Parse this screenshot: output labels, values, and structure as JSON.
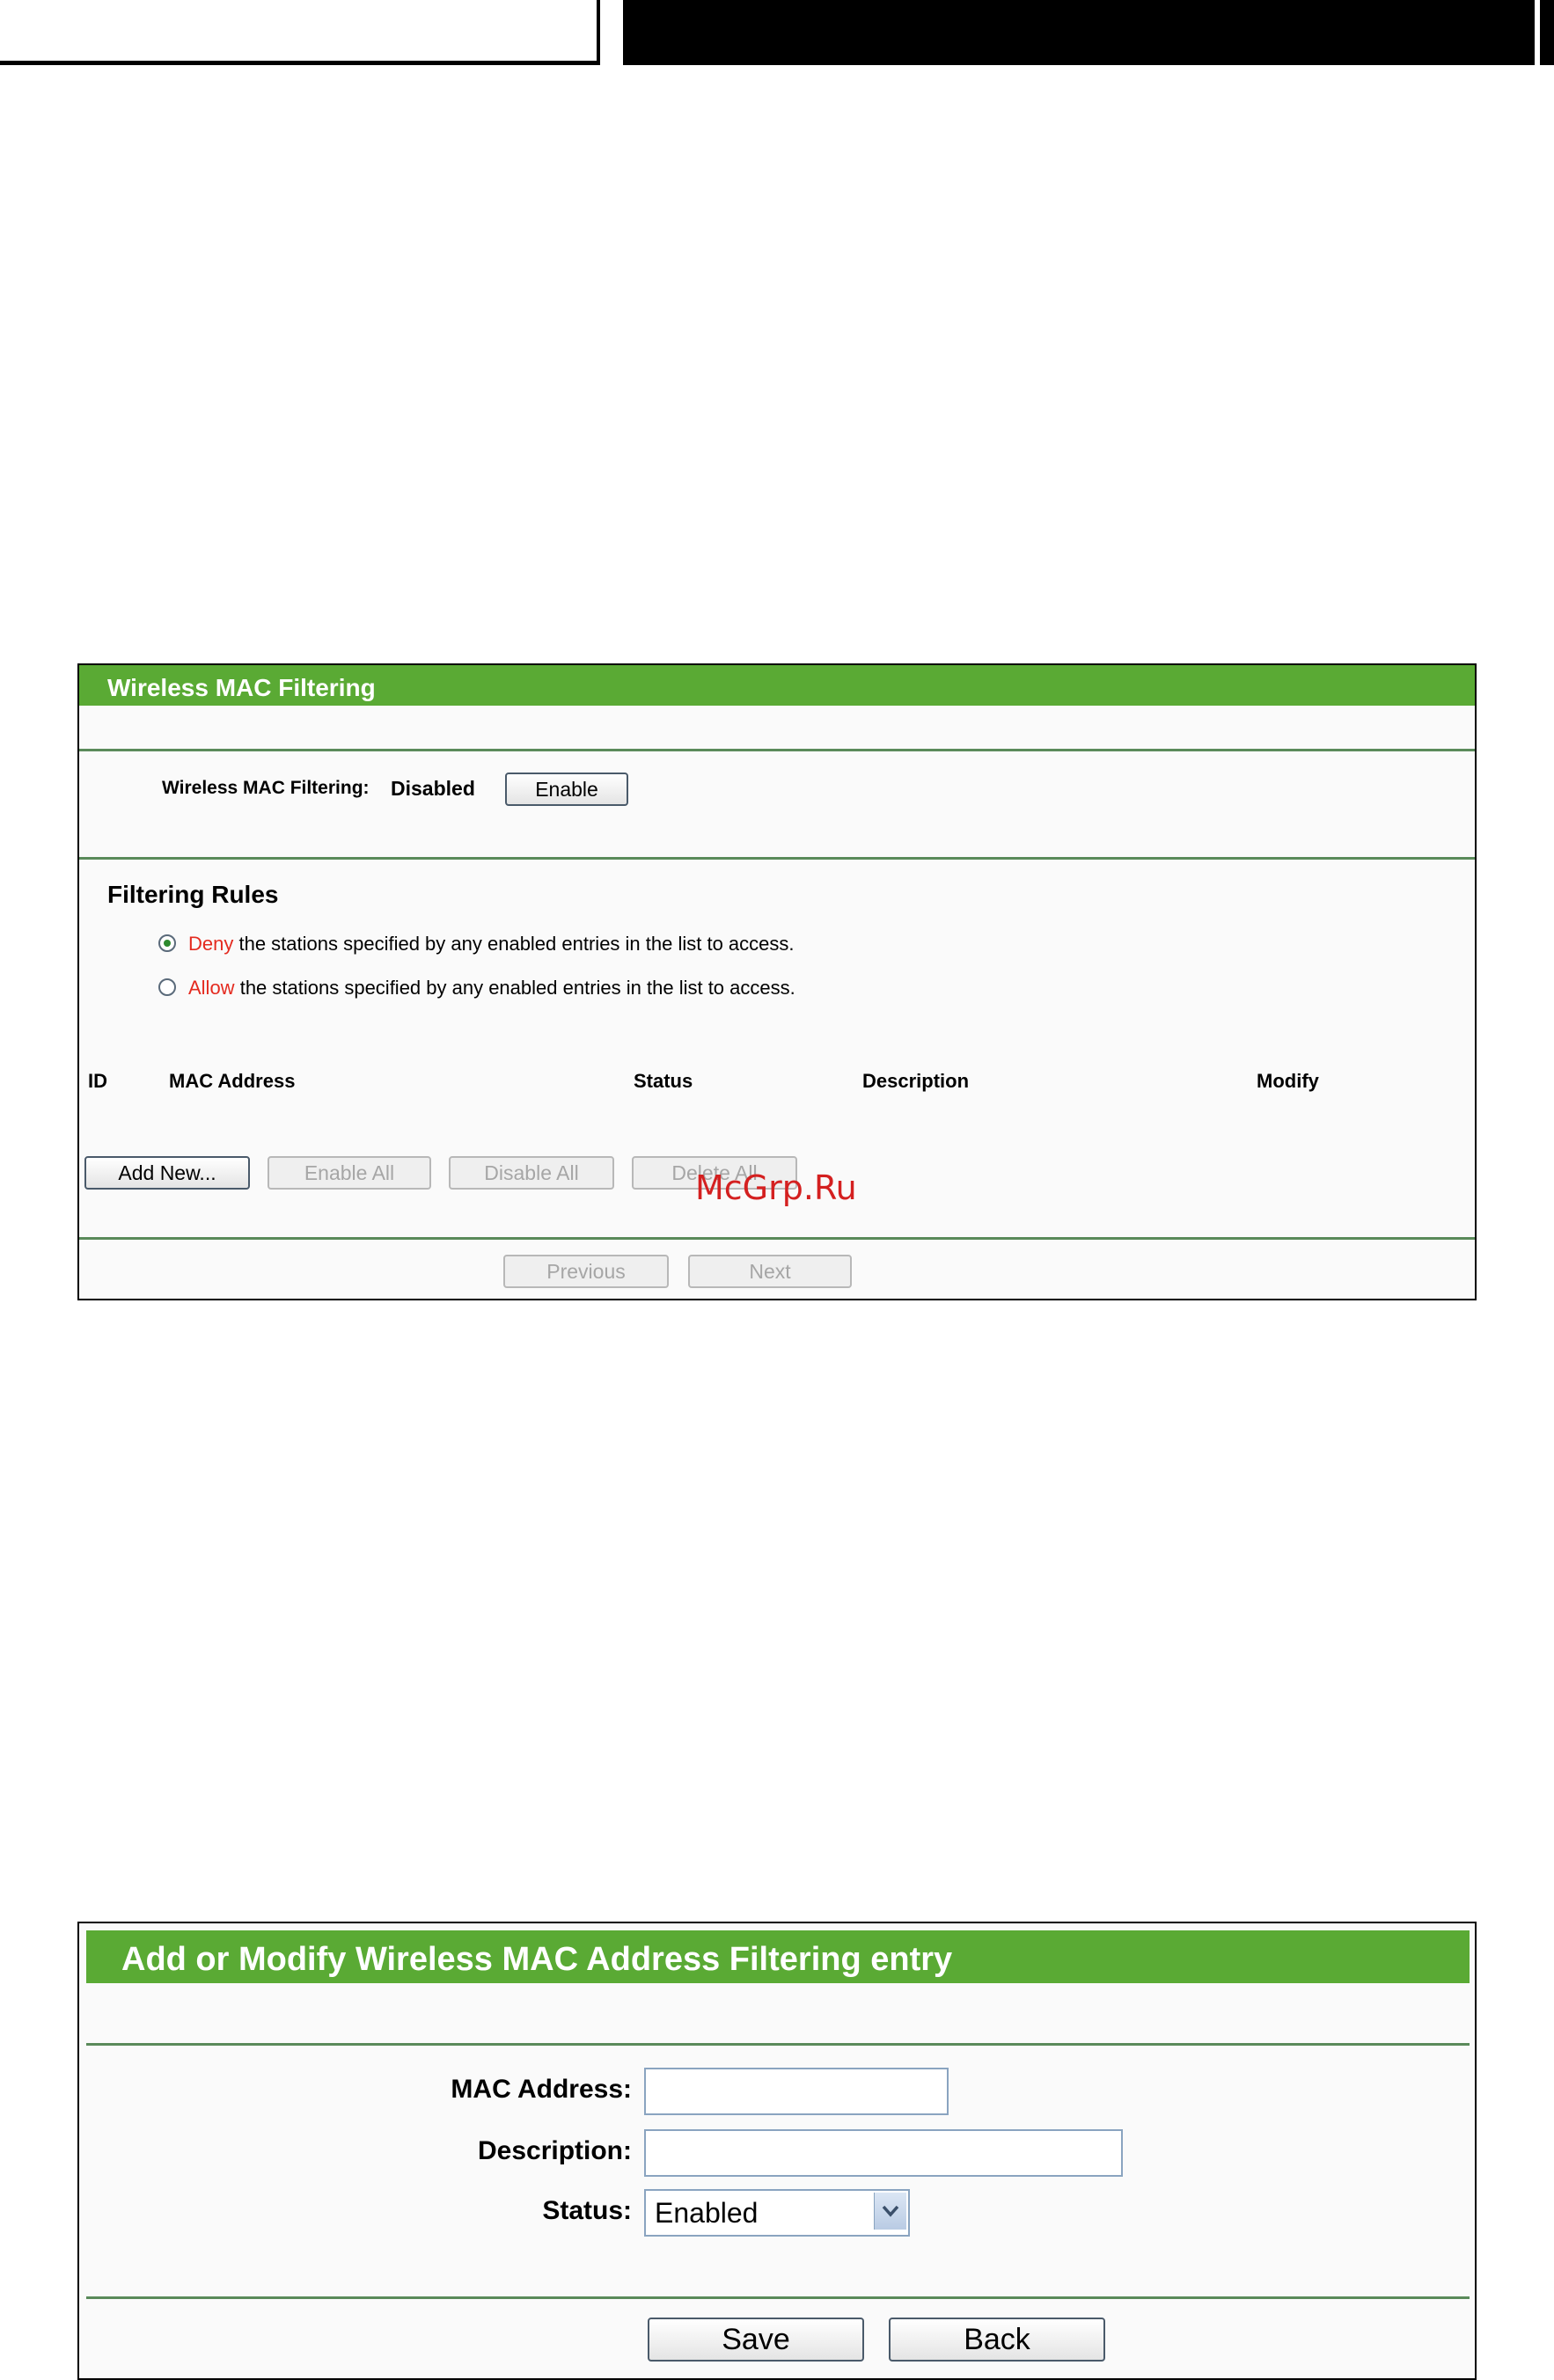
{
  "mac_filtering": {
    "title": "Wireless MAC Filtering",
    "filter_label": "Wireless MAC Filtering:",
    "filter_status": "Disabled",
    "enable_button": "Enable",
    "rules_heading": "Filtering Rules",
    "rule_deny": {
      "keyword": "Deny",
      "text": "the stations specified by any enabled entries in the list to access.",
      "selected": true
    },
    "rule_allow": {
      "keyword": "Allow",
      "text": "the stations specified by any enabled entries in the list to access.",
      "selected": false
    },
    "table_columns": [
      "ID",
      "MAC Address",
      "Status",
      "Description",
      "Modify"
    ],
    "add_new_button": "Add New...",
    "enable_all_button": "Enable All",
    "disable_all_button": "Disable All",
    "delete_all_button": "Delete All",
    "previous_button": "Previous",
    "next_button": "Next"
  },
  "watermark": "McGrp.Ru",
  "add_modify": {
    "title": "Add or Modify Wireless MAC Address Filtering entry",
    "mac_label": "MAC Address:",
    "mac_value": "",
    "description_label": "Description:",
    "description_value": "",
    "status_label": "Status:",
    "status_value": "Enabled",
    "save_button": "Save",
    "back_button": "Back"
  },
  "colors": {
    "header_green": "#5aaa34",
    "accent_red": "#e42a1f"
  },
  "icons": {
    "select_arrow": "chevron-down-icon"
  }
}
